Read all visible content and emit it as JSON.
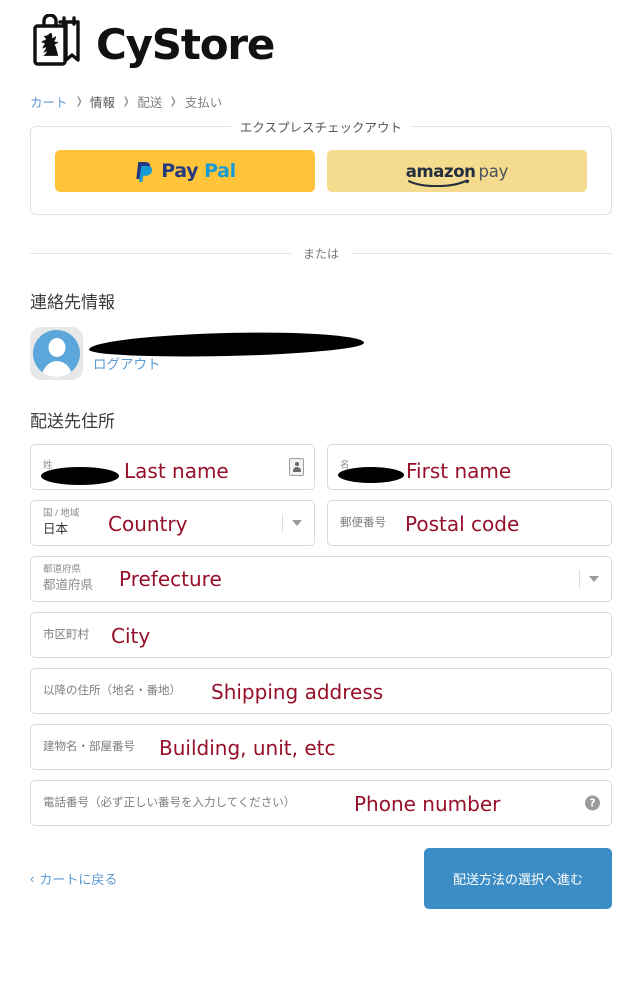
{
  "header": {
    "logo_icon": "shopping-bag-logo-icon",
    "brand": "CyStore"
  },
  "breadcrumb": {
    "items": [
      {
        "label": "カート",
        "state": "link"
      },
      {
        "label": "情報",
        "state": "current"
      },
      {
        "label": "配送",
        "state": "upcoming"
      },
      {
        "label": "支払い",
        "state": "upcoming"
      }
    ],
    "separator": "❯"
  },
  "express_checkout": {
    "legend": "エクスプレスチェックアウト",
    "paypal": {
      "pay": "Pay",
      "pal": "Pal",
      "icon": "paypal-logo-icon"
    },
    "amazon": {
      "amazon": "amazon",
      "pay": "pay",
      "icon": "amazon-pay-logo-icon"
    }
  },
  "divider": {
    "label": "または"
  },
  "contact": {
    "title": "連絡先情報",
    "avatar_icon": "user-avatar-icon",
    "email": "",
    "logout_label": "ログアウト"
  },
  "shipping": {
    "title": "配送先住所",
    "fields": {
      "last_name": {
        "label": "姓",
        "value": "",
        "annotation": "Last name",
        "icon": "contact-card-autofill-icon"
      },
      "first_name": {
        "label": "名",
        "value": "",
        "annotation": "First name"
      },
      "country": {
        "label": "国 / 地域",
        "value": "日本",
        "annotation": "Country",
        "icon": "chevron-down-icon"
      },
      "postal_code": {
        "label": "郵便番号",
        "value": "",
        "annotation": "Postal code"
      },
      "prefecture": {
        "label": "都道府県",
        "value": "都道府県",
        "annotation": "Prefecture",
        "icon": "chevron-down-icon"
      },
      "city": {
        "label": "市区町村",
        "value": "",
        "annotation": "City"
      },
      "address": {
        "label": "以降の住所（地名・番地）",
        "value": "",
        "annotation": "Shipping address"
      },
      "building": {
        "label": "建物名・部屋番号",
        "value": "",
        "annotation": "Building, unit, etc"
      },
      "phone": {
        "label": "電話番号（必ず正しい番号を入力してください）",
        "value": "",
        "annotation": "Phone number",
        "icon": "help-question-icon"
      }
    }
  },
  "footer": {
    "back_chevron": "‹",
    "back_label": "カートに戻る",
    "submit_label": "配送方法の選択へ進む"
  },
  "colors": {
    "link": "#5b9ad4",
    "primary_button": "#3c8dc5",
    "paypal_yellow": "#ffc439",
    "amazon_yellow": "#f5db8d",
    "annotation_red": "#96102a",
    "field_border": "#d9d9d9"
  }
}
